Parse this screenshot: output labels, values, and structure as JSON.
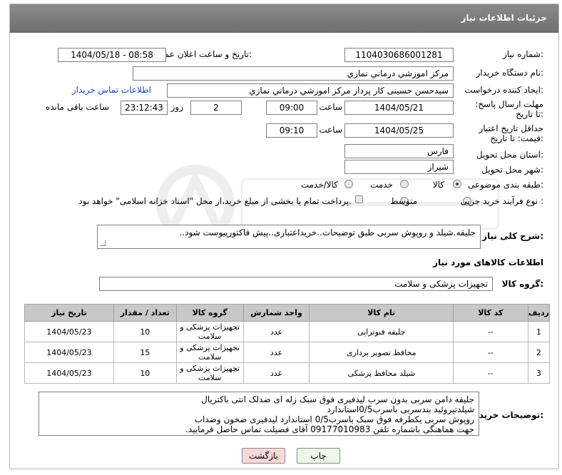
{
  "header": {
    "title": "جزئیات اطلاعات نیاز"
  },
  "fields": {
    "need_number_label": "شماره نیاز:",
    "need_number": "1104030686001281",
    "announce_label": "تاریخ و ساعت اعلان عمومی:",
    "announce_value": "1404/05/18 - 08:58",
    "buyer_org_label": "نام دستگاه خریدار:",
    "buyer_org": "مرکز اموزشي درماني نمازي",
    "creator_label": "ایجاد کننده درخواست:",
    "creator": "سیدحسن حسینی کار پرداز مرکز اموزشي درماني نمازي",
    "buyer_contact_link": "اطلاعات تماس خریدار",
    "reply_deadline_label": "مهلت ارسال پاسخ: تا تاریخ:",
    "reply_date": "1404/05/21",
    "time_label": "ساعت",
    "reply_time": "09:00",
    "days_value": "2",
    "days_label": "روز و",
    "remaining_time": "23:12:43",
    "remaining_label": "ساعت باقی مانده",
    "price_validity_label": "حداقل تاریخ اعتبار قیمت: تا تاریخ:",
    "price_date": "1404/05/25",
    "price_time": "09:10",
    "province_label": "استان محل تحویل:",
    "province": "فارس",
    "city_label": "شهر محل تحویل:",
    "city": "شیراز",
    "category_label": "طبقه بندی موضوعی:",
    "category_options": [
      "کالا",
      "خدمت",
      "کالا/خدمت"
    ],
    "process_label": "نوع فرآیند خرید :",
    "process_options": [
      "جزیی",
      "متوسط"
    ],
    "payment_note": "پرداخت تمام یا بخشی از مبلغ خرید،از محل \"اسناد خزانه اسلامی\" خواهد بود."
  },
  "description": {
    "label": "شرح کلی نیاز:",
    "text": "جلیقه.شیلد و روپوش سربی طبق توضیحات..خریداعتباری..پیش فاکتورپیوست شود.."
  },
  "goods": {
    "section_title": "اطلاعات کالاهای مورد نیاز",
    "group_label": "گروه کالا:",
    "group_value": "تجهیزات پزشکی و سلامت",
    "columns": [
      "ردیف",
      "کد کالا",
      "نام کالا",
      "واحد شمارش",
      "گروه کالا",
      "تعداد / مقدار",
      "تاریخ نیاز"
    ],
    "rows": [
      [
        "1",
        "--",
        "جلیقه فنوتراپی",
        "عدد",
        "تجهیزات پزشکی و سلامت",
        "10",
        "1404/05/23"
      ],
      [
        "2",
        "--",
        "محافظ تصویر برداری",
        "عدد",
        "تجهیزات پزشکی و سلامت",
        "15",
        "1404/05/23"
      ],
      [
        "3",
        "--",
        "شیلد محافظ پزشکی",
        "عدد",
        "تجهیزات پزشکی و سلامت",
        "10",
        "1404/05/23"
      ]
    ]
  },
  "buyer_notes": {
    "label": "توضیحات خریدار:",
    "lines": [
      "جلیقه دامن سربی بدون سرب لیدفیری فوق سبک زله ای ضدلک انتی باکتریال",
      "شیلدتیروئید بندسربی باسرب0/5استاندارد",
      "روپوش سربی یکطرفه فوق سبک باسرب0/5 استاندارد لیدفیری ضخون وضداب",
      "جهت هماهنگی باشماره تلفن 09177010983 آقای فضیلت تماس حاصل فرمایید."
    ]
  },
  "buttons": {
    "print": "چاپ",
    "back": "بازگشت"
  },
  "colors": {
    "title_bar": "#7b7b7b",
    "link": "#1a47c4",
    "table_header": "#c8c8c8",
    "back_button": "#f7d9d9",
    "print_button": "#eef7e8"
  }
}
